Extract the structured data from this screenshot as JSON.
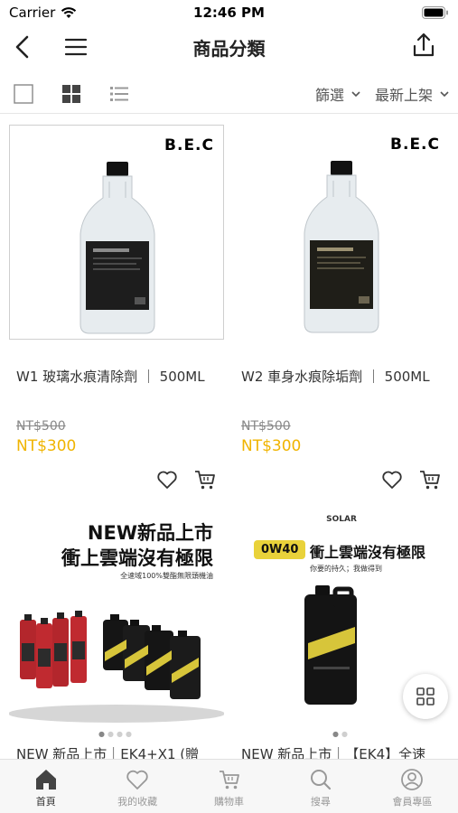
{
  "status_bar": {
    "carrier": "Carrier",
    "time": "12:46 PM"
  },
  "nav": {
    "title": "商品分類"
  },
  "toolbar": {
    "filter_label": "篩選",
    "sort_label": "最新上架"
  },
  "products": [
    {
      "name": "W1 玻璃水痕清除劑 ｜ 500ML",
      "original_price": "NT$500",
      "sale_price": "NT$300",
      "brand": "B.E.C"
    },
    {
      "name": "W2 車身水痕除垢劑 ｜ 500ML",
      "original_price": "NT$500",
      "sale_price": "NT$300",
      "brand": "B.E.C"
    },
    {
      "name": "NEW 新品上市｜EK4+X1 (贈",
      "banner_headline": "NEW新品上市",
      "banner_headline_2": "衝上雲端沒有極限",
      "banner_subtext": "全速域100%雙酯無限頭機油"
    },
    {
      "name": "NEW 新品上市｜【EK4】全速",
      "banner_brand": "SOLAR",
      "banner_grade": "0W40",
      "banner_headline": "衝上雲端沒有極限",
      "banner_subtext": "你要的持久；我做得到"
    }
  ],
  "tabs": [
    {
      "label": "首頁",
      "icon": "home-icon",
      "active": true
    },
    {
      "label": "我的收藏",
      "icon": "heart-icon",
      "active": false
    },
    {
      "label": "購物車",
      "icon": "cart-icon",
      "active": false
    },
    {
      "label": "搜尋",
      "icon": "search-icon",
      "active": false
    },
    {
      "label": "會員專區",
      "icon": "user-icon",
      "active": false
    }
  ],
  "colors": {
    "sale_price": "#f0b400",
    "text": "#222222",
    "muted": "#999999",
    "tabbar_bg": "#f7f7f7"
  }
}
